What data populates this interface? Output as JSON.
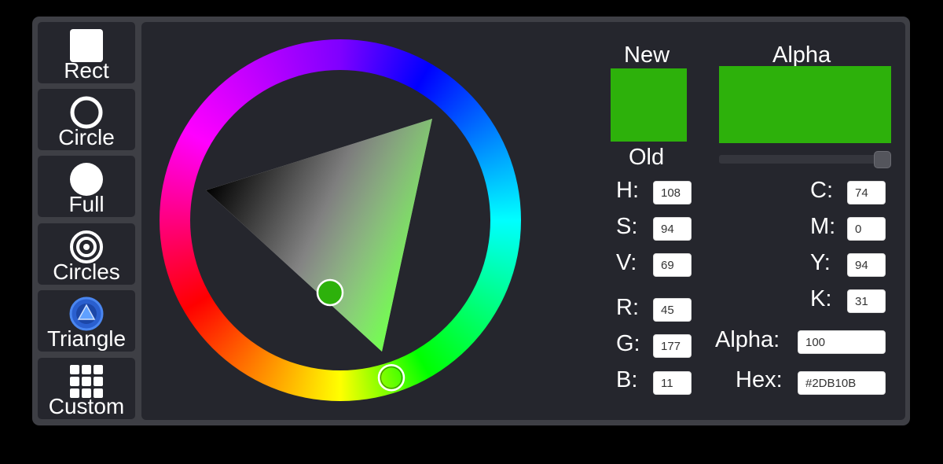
{
  "sidebar": {
    "items": [
      {
        "label": "Rect",
        "icon": "square-icon"
      },
      {
        "label": "Circle",
        "icon": "ring-icon"
      },
      {
        "label": "Full",
        "icon": "filled-circle-icon"
      },
      {
        "label": "Circles",
        "icon": "concentric-circles-icon"
      },
      {
        "label": "Triangle",
        "icon": "triangle-icon",
        "selected": true
      },
      {
        "label": "Custom",
        "icon": "grid-icon"
      }
    ],
    "selected_color": "#2a5fcf"
  },
  "preview": {
    "new_label": "New",
    "old_label": "Old",
    "alpha_label": "Alpha",
    "new_color": "#2DB10B",
    "old_color": "#2DB10B",
    "alpha_slider_fraction": 1.0
  },
  "hsv": {
    "h_label": "H:",
    "h": "108",
    "s_label": "S:",
    "s": "94",
    "v_label": "V:",
    "v": "69"
  },
  "rgb": {
    "r_label": "R:",
    "r": "45",
    "g_label": "G:",
    "g": "177",
    "b_label": "B:",
    "b": "11"
  },
  "cmyk": {
    "c_label": "C:",
    "c": "74",
    "m_label": "M:",
    "m": "0",
    "y_label": "Y:",
    "y": "94",
    "k_label": "K:",
    "k": "31"
  },
  "alpha": {
    "label": "Alpha:",
    "value": "100"
  },
  "hex": {
    "label": "Hex:",
    "value": "#2DB10B"
  },
  "picker": {
    "hue": 108,
    "saturation": 0.94,
    "value": 0.69,
    "hue_color": "#3BFF0A"
  }
}
